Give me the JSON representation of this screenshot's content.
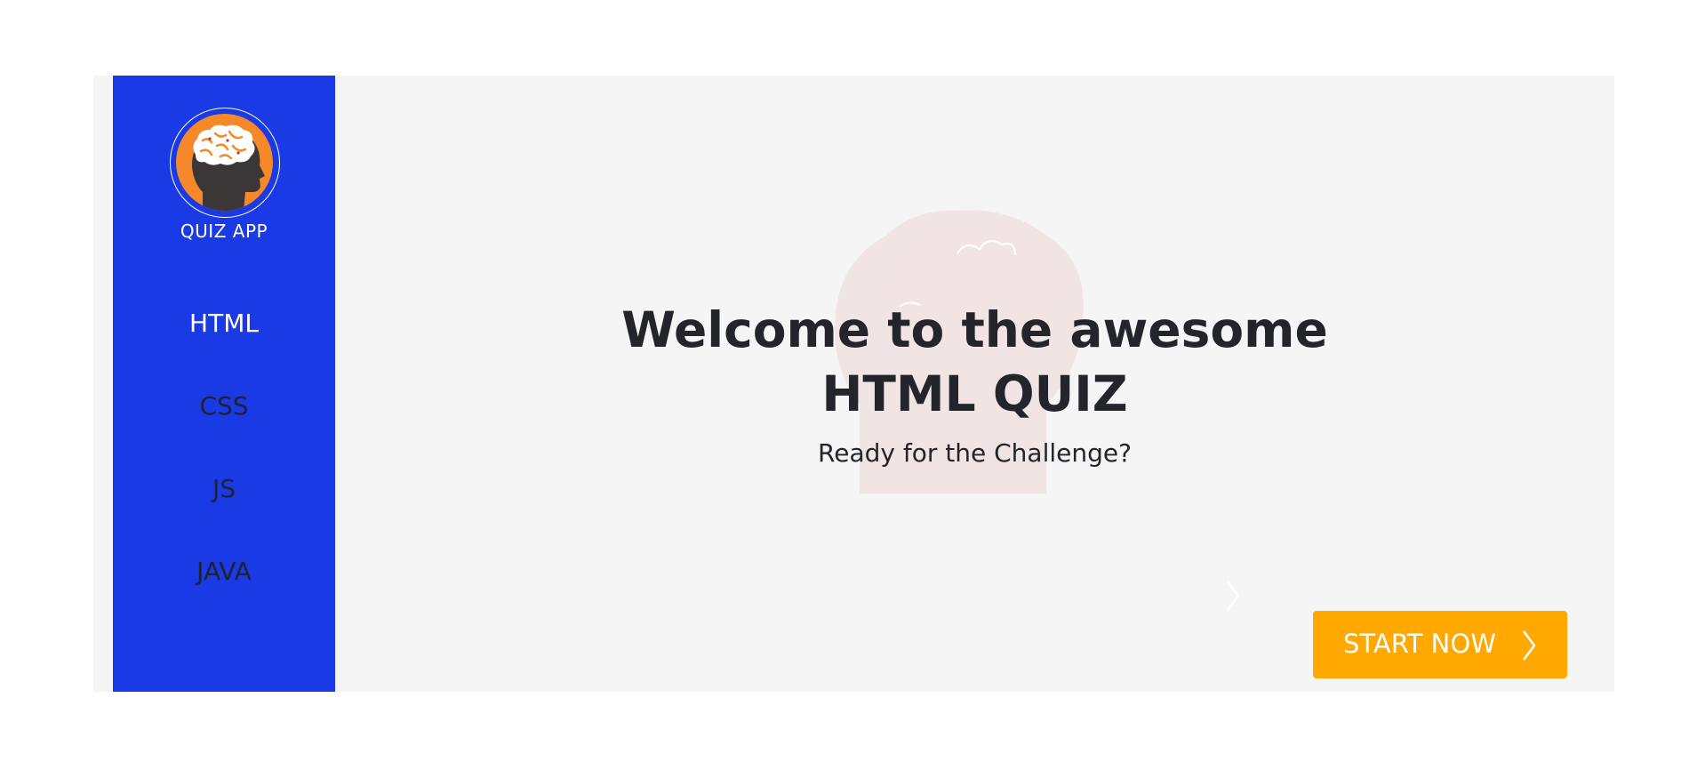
{
  "app": {
    "name": "QUIZ APP",
    "logo_icon": "brain-head-icon"
  },
  "sidebar": {
    "items": [
      {
        "label": "HTML",
        "active": true
      },
      {
        "label": "CSS",
        "active": false
      },
      {
        "label": "JS",
        "active": false
      },
      {
        "label": "JAVA",
        "active": false
      }
    ]
  },
  "main": {
    "title_line1": "Welcome to the awesome",
    "title_line2": "HTML QUIZ",
    "subtitle": "Ready for the Challenge?",
    "background_icon": "brain-head-watermark-icon",
    "start_button": {
      "label": "START NOW",
      "icon": "chevron-right-icon"
    }
  },
  "colors": {
    "sidebar_bg": "#1a3ae6",
    "accent": "#ffa800",
    "logo_bg": "#f5892a",
    "main_bg": "#f5f5f5",
    "text_dark": "#23252b"
  }
}
